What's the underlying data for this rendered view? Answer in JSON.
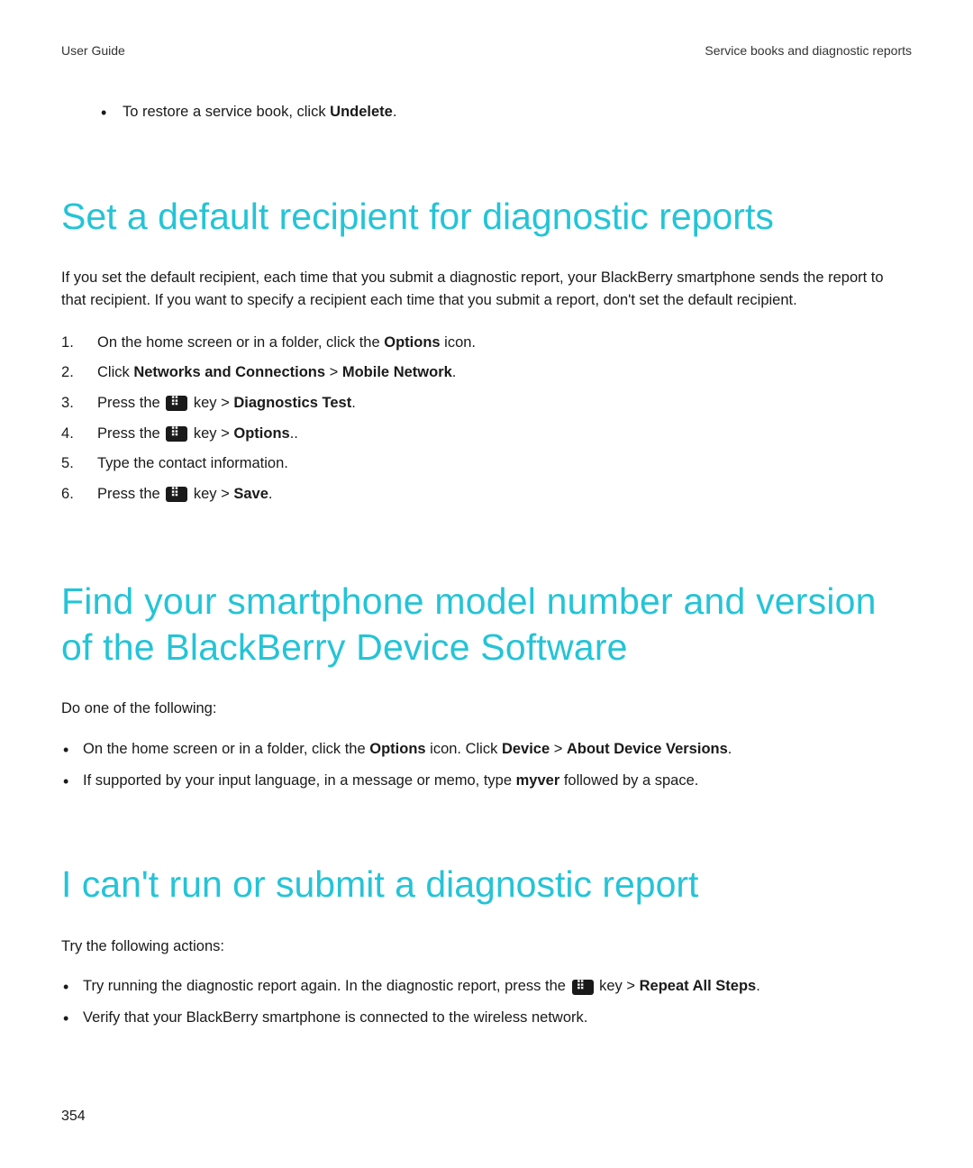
{
  "header": {
    "left": "User Guide",
    "right": "Service books and diagnostic reports"
  },
  "intro_bullet": {
    "prefix": "To restore a service book, click ",
    "bold": "Undelete",
    "suffix": "."
  },
  "section1": {
    "heading": "Set a default recipient for diagnostic reports",
    "intro": "If you set the default recipient, each time that you submit a diagnostic report, your BlackBerry smartphone sends the report to that recipient. If you want to specify a recipient each time that you submit a report, don't set the default recipient.",
    "steps": {
      "s1_prefix": "On the home screen or in a folder, click the ",
      "s1_bold": "Options",
      "s1_suffix": " icon.",
      "s2_prefix": "Click ",
      "s2_bold1": "Networks and Connections",
      "s2_sep": " > ",
      "s2_bold2": "Mobile Network",
      "s2_suffix": ".",
      "s3_prefix": "Press the ",
      "s3_mid": " key > ",
      "s3_bold": "Diagnostics Test",
      "s3_suffix": ".",
      "s4_prefix": "Press the ",
      "s4_mid": " key > ",
      "s4_bold": "Options",
      "s4_suffix": "..",
      "s5": "Type the contact information.",
      "s6_prefix": "Press the ",
      "s6_mid": " key > ",
      "s6_bold": "Save",
      "s6_suffix": "."
    }
  },
  "section2": {
    "heading": "Find your smartphone model number and version of the BlackBerry Device Software",
    "intro": "Do one of the following:",
    "bullets": {
      "b1_p1": "On the home screen or in a folder, click the ",
      "b1_b1": "Options",
      "b1_p2": " icon. Click ",
      "b1_b2": "Device",
      "b1_sep": " > ",
      "b1_b3": "About Device Versions",
      "b1_suffix": ".",
      "b2_p1": "If supported by your input language, in a message or memo, type ",
      "b2_b1": "myver",
      "b2_p2": " followed by a space."
    }
  },
  "section3": {
    "heading": "I can't run or submit a diagnostic report",
    "intro": "Try the following actions:",
    "bullets": {
      "b1_p1": "Try running the diagnostic report again. In the diagnostic report, press the ",
      "b1_mid": " key > ",
      "b1_bold": "Repeat All Steps",
      "b1_suffix": ".",
      "b2": "Verify that your BlackBerry smartphone is connected to the wireless network."
    }
  },
  "page_number": "354"
}
